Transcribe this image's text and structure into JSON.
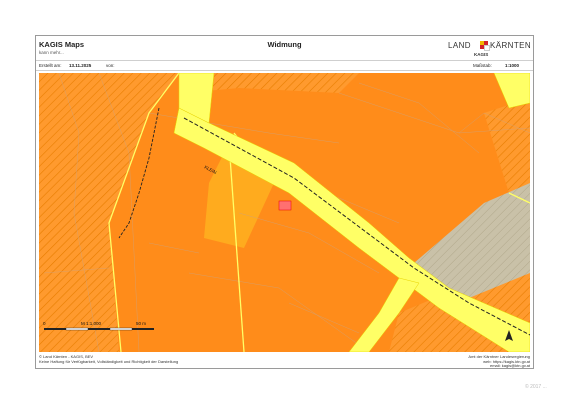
{
  "header": {
    "app_title": "KAGIS Maps",
    "app_subtitle": "kann mehr...",
    "doc_title": "Widmung",
    "logo_left": "LAND",
    "logo_right": "KÄRNTEN",
    "logo_sub": "KAGIS"
  },
  "meta": {
    "created_label": "Erstellt am:",
    "created_value": "13.11.2025",
    "by_label": "von:",
    "scale_label": "Maßstab:",
    "scale_value": "1:1000"
  },
  "map": {
    "scalebar": {
      "start": "0",
      "middle": "M 1:1.000",
      "end": "50 m"
    },
    "colors": {
      "building_land": "#ff8c1a",
      "road": "#ffff66",
      "grey_zone": "#c4bca6",
      "hatch": "#e77d00",
      "parcel_line": "#b8b8b8",
      "railway": "#222222"
    },
    "north_arrow_icon": "north-arrow-icon"
  },
  "footer": {
    "left_line1": "© Land Kärnten - KAGIS, BEV",
    "left_line2": "Keine Haftung für Verfügbarkeit, Vollständigkeit und Richtigkeit der Darstellung",
    "right_line1": "Amt der Kärntner Landesregierung",
    "right_line2": "web: https://kagis.ktn.gv.at",
    "right_line3": "email: kagis@ktn.gv.at"
  },
  "watermark": "© 2017 ..."
}
